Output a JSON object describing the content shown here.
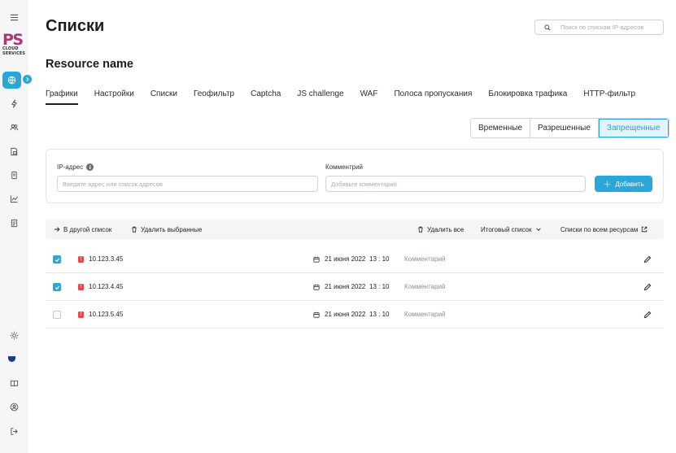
{
  "page": {
    "title": "Списки",
    "resource_name": "Resource name"
  },
  "search": {
    "placeholder": "Поиск по спискам IP-адресов"
  },
  "logo": {
    "letters": "PS",
    "line1": "CLOUD",
    "line2": "SERVICES"
  },
  "sidebar": {
    "top_icons": [
      "menu-icon"
    ],
    "items": [
      "globe-icon",
      "lightning-icon",
      "users-icon",
      "document-lock-icon",
      "file-icon",
      "chart-icon",
      "report-icon"
    ],
    "bottom_icons": [
      "sun-icon",
      "theme-icon",
      "book-icon",
      "user-circle-icon",
      "logout-icon"
    ]
  },
  "tabs": [
    "Графики",
    "Настройки",
    "Списки",
    "Геофильтр",
    "Captcha",
    "JS challenge",
    "WAF",
    "Полоса пропускания",
    "Блокировка трафика",
    "HTTP-фильтр"
  ],
  "active_tab": "Графики",
  "segments": [
    "Временные",
    "Разрешенные",
    "Запрещенные"
  ],
  "active_segment": "Запрещенные",
  "form": {
    "ip_label": "IP-адрес",
    "ip_info": "i",
    "ip_placeholder": "Введите адрес или список адресов",
    "comment_label": "Комментрий",
    "comment_placeholder": "Добавьте комментарий",
    "add_label": "Добавить"
  },
  "toolbar": {
    "move": "В другой список",
    "delete_selected": "Удалить выбранные",
    "delete_all": "Удалить все",
    "final_list": "Итоговый список",
    "all_resources": "Списки по всем ресурсам"
  },
  "rows": [
    {
      "ip": "10.123.3.45",
      "date": "21 июня 2022",
      "time": "13 : 10",
      "comment": "Комментарий",
      "checked": true,
      "warn": "!"
    },
    {
      "ip": "10.123.4.45",
      "date": "21 июня 2022",
      "time": "13 : 10",
      "comment": "Комментарий",
      "checked": true,
      "warn": "!"
    },
    {
      "ip": "10.123.5.45",
      "date": "21 июня 2022",
      "time": "13 : 10",
      "comment": "Комментарий",
      "checked": false,
      "warn": "!"
    }
  ],
  "colors": {
    "accent": "#2aa7d8",
    "brand": "#b0357b",
    "danger": "#e5484d"
  }
}
